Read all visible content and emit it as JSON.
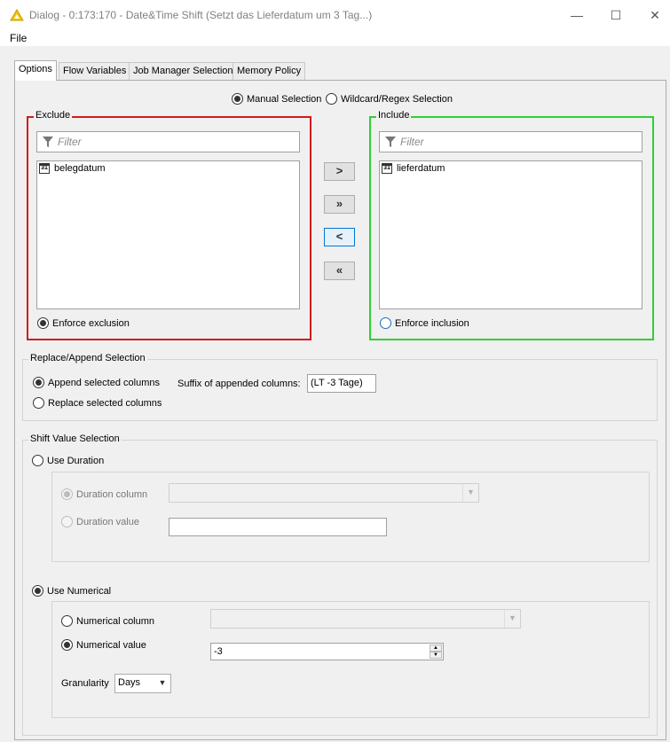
{
  "window": {
    "title": "Dialog - 0:173:170 - Date&Time Shift (Setzt das Lieferdatum um 3 Tag...)",
    "icon": "knime-warning-triangle-icon",
    "minimize_glyph": "—",
    "maximize_glyph": "☐",
    "close_glyph": "✕"
  },
  "menu": {
    "file": "File"
  },
  "tabs": [
    {
      "label": "Options",
      "active": true
    },
    {
      "label": "Flow Variables",
      "active": false
    },
    {
      "label": "Job Manager Selection",
      "active": false
    },
    {
      "label": "Memory Policy",
      "active": false
    }
  ],
  "selection_mode": {
    "manual": "Manual Selection",
    "wildcard": "Wildcard/Regex Selection",
    "selected": "manual"
  },
  "exclude": {
    "title": "Exclude",
    "filter_placeholder": "Filter",
    "items": [
      "belegdatum"
    ],
    "enforce_label": "Enforce exclusion",
    "enforce_selected": true,
    "border_color": "#d31a1a"
  },
  "include": {
    "title": "Include",
    "filter_placeholder": "Filter",
    "items": [
      "lieferdatum"
    ],
    "enforce_label": "Enforce inclusion",
    "enforce_selected": false,
    "border_color": "#2fcf33"
  },
  "move_buttons": {
    "add": ">",
    "add_all": "»",
    "remove": "<",
    "remove_all": "«"
  },
  "replace_append": {
    "title": "Replace/Append Selection",
    "append_label": "Append selected columns",
    "replace_label": "Replace selected columns",
    "selected": "append",
    "suffix_label": "Suffix of appended columns:",
    "suffix_value": "(LT -3 Tage)"
  },
  "shift_value": {
    "title": "Shift Value Selection",
    "use_duration_label": "Use Duration",
    "duration_column_label": "Duration column",
    "duration_value_label": "Duration value",
    "use_numerical_label": "Use Numerical",
    "numerical_column_label": "Numerical column",
    "numerical_value_label": "Numerical value",
    "numerical_value": "-3",
    "granularity_label": "Granularity",
    "granularity_value": "Days",
    "selected_mode": "numerical",
    "selected_numerical_source": "value"
  }
}
